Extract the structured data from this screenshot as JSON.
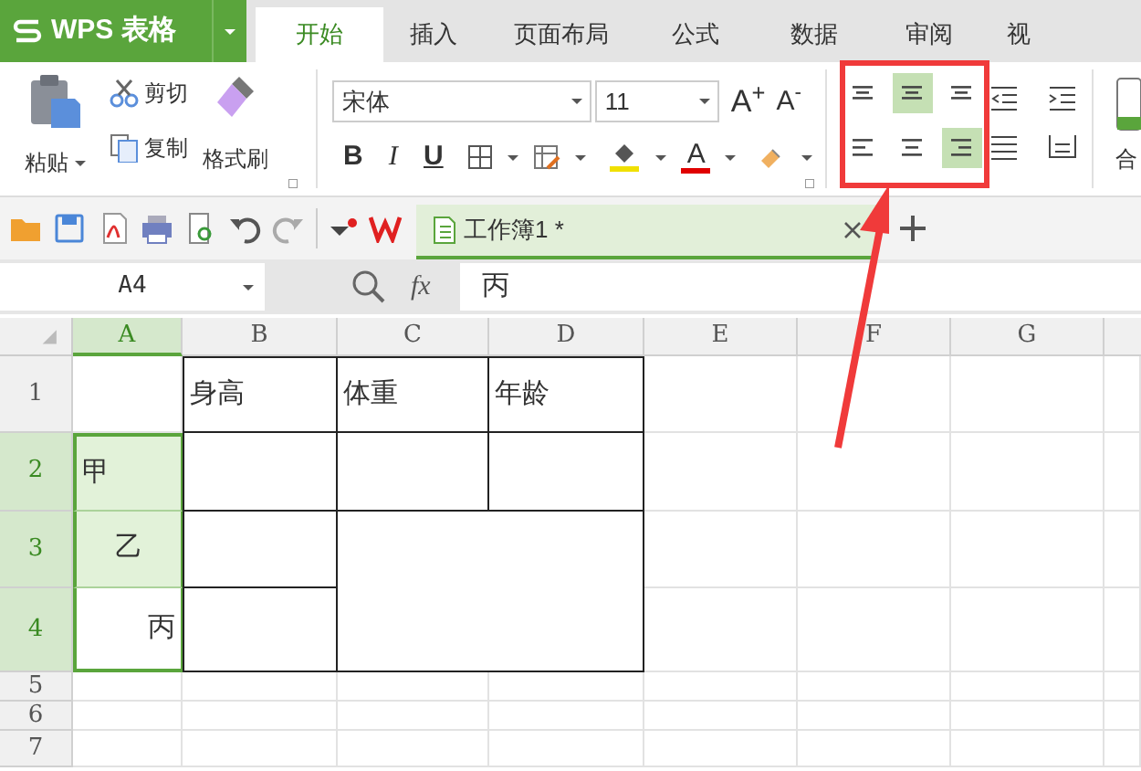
{
  "app_menu": {
    "label": "WPS 表格"
  },
  "tabs": [
    {
      "label": "开始",
      "selected": true
    },
    {
      "label": "插入",
      "selected": false
    },
    {
      "label": "页面布局",
      "selected": false
    },
    {
      "label": "公式",
      "selected": false
    },
    {
      "label": "数据",
      "selected": false
    },
    {
      "label": "审阅",
      "selected": false
    },
    {
      "label": "视",
      "selected": false
    }
  ],
  "clipboard": {
    "paste": "粘贴",
    "cut": "剪切",
    "copy": "复制",
    "format_painter": "格式刷"
  },
  "font": {
    "name": "宋体",
    "size": "11",
    "grow": "A$^{+}$",
    "shrink": "A$^{-}$",
    "color_label": "A"
  },
  "format_buttons": [
    {
      "label": "B",
      "kind": "bold"
    },
    {
      "label": "I",
      "kind": "italic"
    },
    {
      "label": "U",
      "kind": "underline"
    }
  ],
  "align_buttons": [
    {
      "kind": "top",
      "selected": false
    },
    {
      "kind": "middle",
      "selected": true
    },
    {
      "kind": "bottom",
      "selected": false
    },
    {
      "kind": "left",
      "selected": false
    },
    {
      "kind": "center",
      "selected": false
    },
    {
      "kind": "right",
      "selected": true
    }
  ],
  "merge_label": "合",
  "document_tab": {
    "title": "工作簿1 *"
  },
  "name_box": {
    "value": "A4"
  },
  "formula_bar": {
    "fx": "fx",
    "value": "丙"
  },
  "sheet": {
    "columns": [
      {
        "label": "A",
        "selected": true
      },
      {
        "label": "B",
        "selected": false
      },
      {
        "label": "C",
        "selected": false
      },
      {
        "label": "D",
        "selected": false
      },
      {
        "label": "E",
        "selected": false
      },
      {
        "label": "F",
        "selected": false
      },
      {
        "label": "G",
        "selected": false
      }
    ],
    "rows": [
      {
        "label": "1",
        "selected": false,
        "cells": [
          {
            "kind": "blank",
            "bordered": false,
            "selected": false
          },
          {
            "kind": "left",
            "text": "身高",
            "bordered": true,
            "selected": false
          },
          {
            "kind": "left",
            "text": "体重",
            "bordered": true,
            "selected": false
          },
          {
            "kind": "left",
            "text": "年龄",
            "bordered": true,
            "selected": false
          }
        ]
      },
      {
        "label": "2",
        "selected": true,
        "cells": [
          {
            "kind": "left",
            "text": "甲",
            "bordered": false,
            "selected": true,
            "active": false
          },
          {
            "kind": "blank",
            "bordered": true,
            "selected": false
          },
          {
            "kind": "blank",
            "bordered": true,
            "selected": false
          },
          {
            "kind": "blank",
            "bordered": true,
            "selected": false
          }
        ]
      },
      {
        "label": "3",
        "selected": true,
        "cells": [
          {
            "kind": "center",
            "text": "乙",
            "bordered": false,
            "selected": true,
            "active": false
          },
          {
            "kind": "blank",
            "bordered": true,
            "selected": false
          },
          {
            "kind": "merged",
            "bordered": true,
            "selected": false
          }
        ]
      },
      {
        "label": "4",
        "selected": true,
        "cells": [
          {
            "kind": "right",
            "text": "丙",
            "bordered": false,
            "selected": true,
            "active": true
          },
          {
            "kind": "blank",
            "bordered": true,
            "selected": false
          }
        ]
      },
      {
        "label": "5",
        "selected": false
      },
      {
        "label": "6",
        "selected": false
      },
      {
        "label": "7",
        "selected": false
      }
    ]
  }
}
